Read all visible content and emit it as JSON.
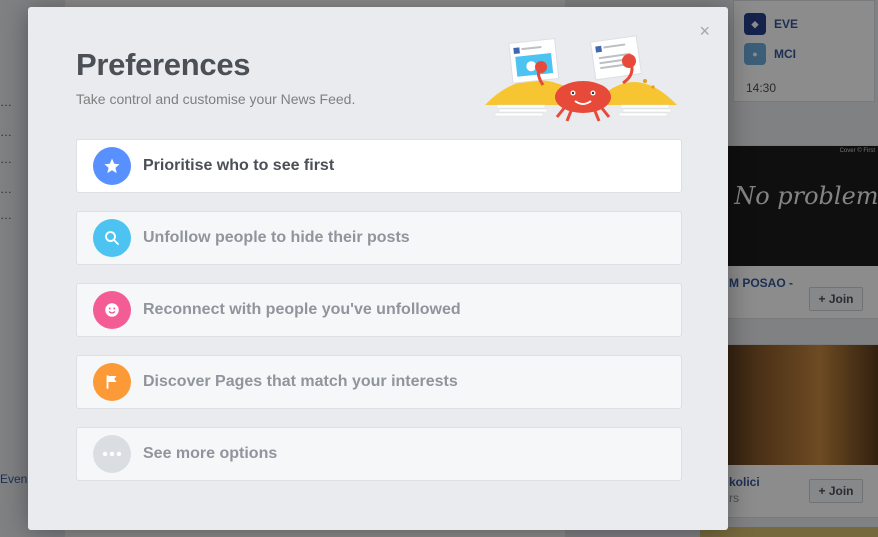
{
  "modal": {
    "title": "Preferences",
    "subtitle": "Take control and customise your News Feed.",
    "close_label": "×",
    "options": [
      {
        "label": "Prioritise who to see first",
        "icon": "star-icon",
        "color": "#5890ff"
      },
      {
        "label": "Unfollow people to hide their posts",
        "icon": "search-icon",
        "color": "#4cc3f0"
      },
      {
        "label": "Reconnect with people you've unfollowed",
        "icon": "smiley-icon",
        "color": "#f35c95"
      },
      {
        "label": "Discover Pages that match your interests",
        "icon": "flag-icon",
        "color": "#fb9a36"
      },
      {
        "label": "See more options",
        "icon": "more-dots-icon",
        "color": "#dadde1"
      }
    ]
  },
  "background": {
    "left_events_label": "Even",
    "scores": [
      {
        "team": "EVE",
        "color": "#27408b"
      },
      {
        "team": "MCI",
        "color": "#6cabdd"
      }
    ],
    "score_time": "14:30",
    "groups": [
      {
        "image_text": "y No problem",
        "image_credit": "Cover © First",
        "title": "M POSAO -",
        "join_label": "+ Join"
      },
      {
        "title": "kolici",
        "subtitle": "rs",
        "join_label": "+ Join"
      }
    ]
  }
}
